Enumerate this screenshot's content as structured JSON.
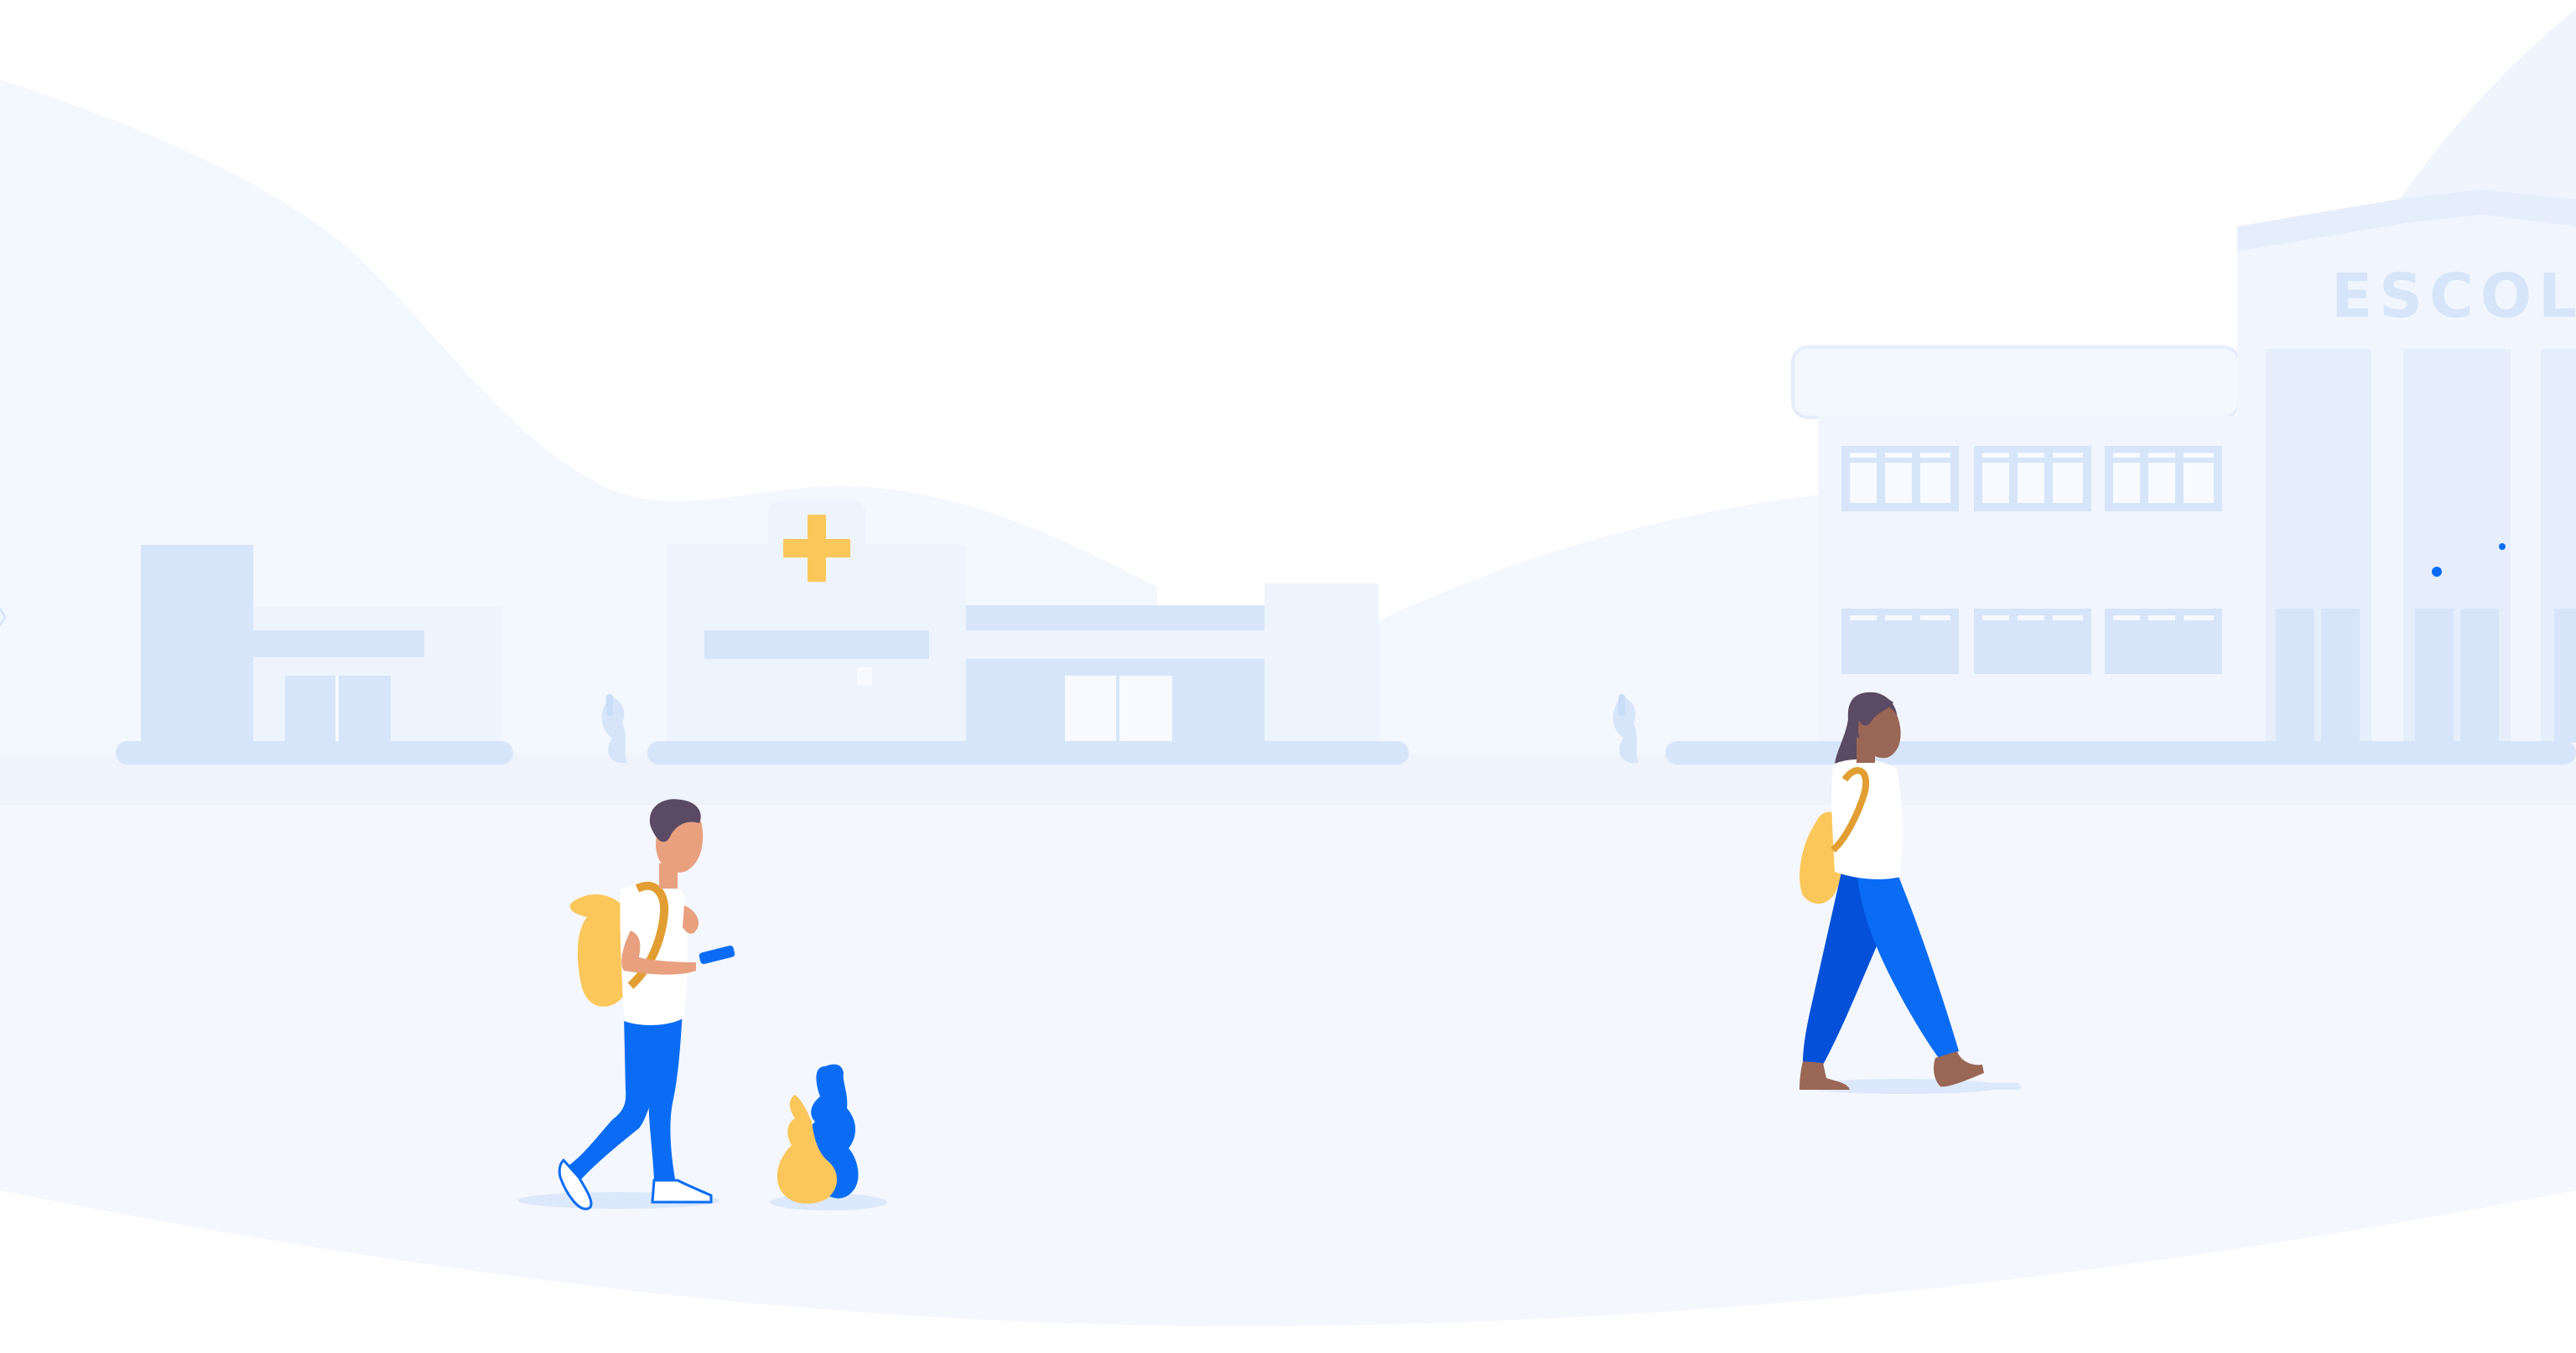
{
  "scene": {
    "colors": {
      "background": "#FFFFFF",
      "hill": "#F5F8FE",
      "building_light": "#EEF4FD",
      "building": "#D6E5FA",
      "building_trim": "#C9DCF8",
      "window": "#F7FAFF",
      "accent_yellow": "#FBC75A",
      "accent_blue": "#0A6CF5",
      "accent_blue_dark": "#0450D8",
      "skin_light": "#E8A07F",
      "skin_dark": "#9A6655",
      "hair": "#5B4A63"
    },
    "school": {
      "sign_text": "ESCOLA"
    },
    "clinic": {
      "sign_icon": "medical-cross-icon"
    },
    "characters": [
      {
        "name_icon": "boy-with-backpack-and-phone-icon"
      },
      {
        "name_icon": "girl-with-backpack-walking-icon"
      }
    ]
  }
}
